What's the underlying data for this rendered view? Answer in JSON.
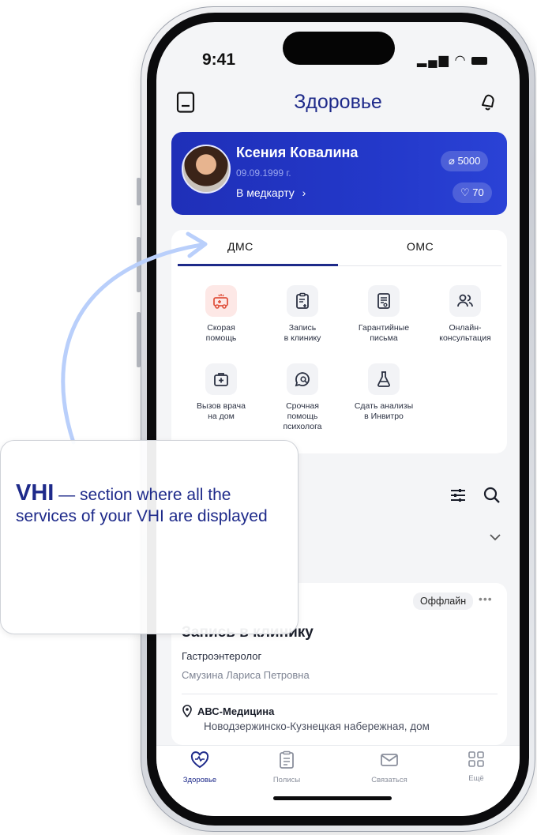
{
  "status_bar": {
    "time": "9:41"
  },
  "header": {
    "title": "Здоровье",
    "left_icon": "book-icon",
    "right_icon": "bell-icon"
  },
  "profile_card": {
    "name": "Ксения Ковалина",
    "birth_date": "09.09.1999 г.",
    "medcard_link": "В медкарту",
    "points": "5000",
    "likes": "70"
  },
  "tabs": [
    {
      "label": "ДМС",
      "active": true
    },
    {
      "label": "ОМС",
      "active": false
    }
  ],
  "services": [
    {
      "label": "Скорая\nпомощь",
      "icon": "ambulance-icon"
    },
    {
      "label": "Запись\nв клинику",
      "icon": "clipboard-plus-icon"
    },
    {
      "label": "Гарантийные\nписьма",
      "icon": "document-icon"
    },
    {
      "label": "Онлайн-\nконсультация",
      "icon": "people-icon"
    },
    {
      "label": "Вызов врача\nна дом",
      "icon": "medkit-icon"
    },
    {
      "label": "Срочная\nпомощь\nпсихолога",
      "icon": "chat-search-icon"
    },
    {
      "label": "Сдать анализы\nв Инвитро",
      "icon": "flask-icon"
    }
  ],
  "appointment": {
    "badge": "Оффлайн",
    "title": "Запись в клинику",
    "specialty": "Гастроэнтеролог",
    "doctor": "Смузина Лариса Петровна",
    "clinic_name": "АВС-Медицина",
    "clinic_address": "Новодзержинско-Кузнецкая набережная, дом"
  },
  "tabbar": [
    {
      "label": "Здоровье",
      "icon": "heart-pulse-icon",
      "active": true
    },
    {
      "label": "Полисы",
      "icon": "clipboard-icon",
      "active": false
    },
    {
      "label": "Связаться",
      "icon": "envelope-icon",
      "active": false
    },
    {
      "label": "Ещё",
      "icon": "grid-icon",
      "active": false
    }
  ],
  "callout": {
    "title": "VHI",
    "text": " — section where all the services of your VHI are displayed"
  },
  "colors": {
    "brand": "#1e2a8a",
    "card": "#2338c9",
    "arrow": "#b9cffb"
  }
}
